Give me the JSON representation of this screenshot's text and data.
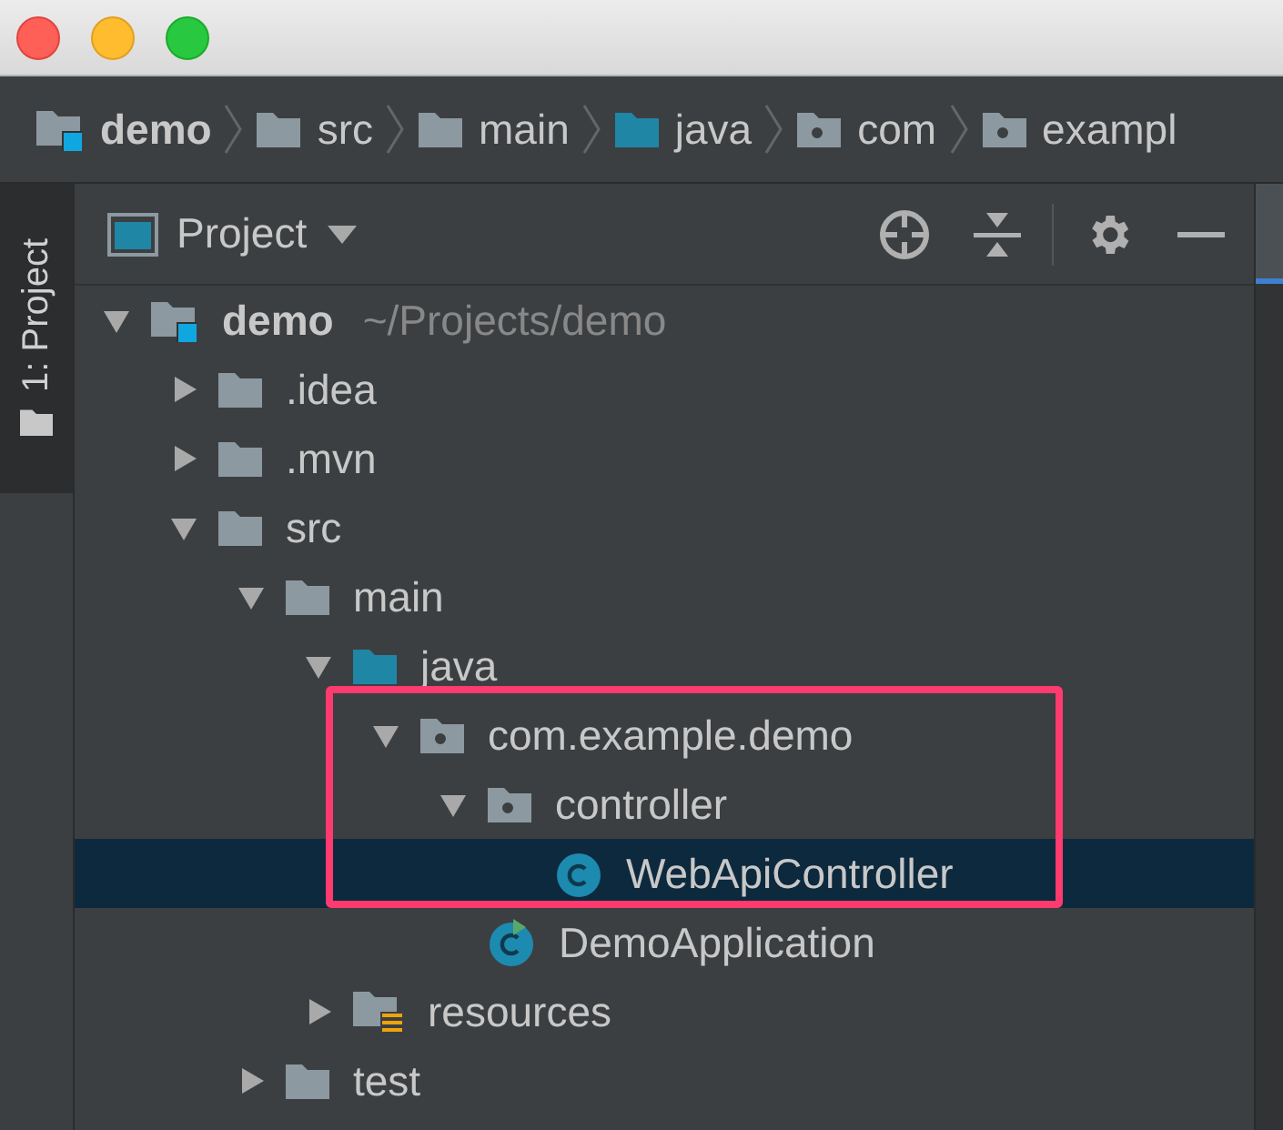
{
  "breadcrumbs": [
    {
      "label": "demo",
      "kind": "module"
    },
    {
      "label": "src",
      "kind": "folder"
    },
    {
      "label": "main",
      "kind": "folder"
    },
    {
      "label": "java",
      "kind": "source"
    },
    {
      "label": "com",
      "kind": "package"
    },
    {
      "label": "exampl",
      "kind": "package"
    }
  ],
  "tool_stripe": {
    "tabs": [
      {
        "label": "1: Project",
        "selected": true
      }
    ]
  },
  "panel": {
    "title": "Project"
  },
  "tree": [
    {
      "label": "demo",
      "hint": "~/Projects/demo",
      "kind": "module",
      "expanded": true,
      "selected": false,
      "children": [
        {
          "label": ".idea",
          "kind": "folder",
          "expanded": false,
          "selected": false
        },
        {
          "label": ".mvn",
          "kind": "folder",
          "expanded": false,
          "selected": false
        },
        {
          "label": "src",
          "kind": "folder",
          "expanded": true,
          "selected": false,
          "children": [
            {
              "label": "main",
              "kind": "folder",
              "expanded": true,
              "selected": false,
              "children": [
                {
                  "label": "java",
                  "kind": "source",
                  "expanded": true,
                  "selected": false,
                  "children": [
                    {
                      "label": "com.example.demo",
                      "kind": "package",
                      "expanded": true,
                      "selected": false,
                      "children": [
                        {
                          "label": "controller",
                          "kind": "package",
                          "expanded": true,
                          "selected": false,
                          "children": [
                            {
                              "label": "WebApiController",
                              "kind": "class",
                              "selected": true
                            }
                          ]
                        },
                        {
                          "label": "DemoApplication",
                          "kind": "app",
                          "selected": false
                        }
                      ]
                    }
                  ]
                },
                {
                  "label": "resources",
                  "kind": "resources",
                  "expanded": false,
                  "selected": false
                }
              ]
            },
            {
              "label": "test",
              "kind": "folder",
              "expanded": false,
              "selected": false
            }
          ]
        }
      ]
    }
  ]
}
